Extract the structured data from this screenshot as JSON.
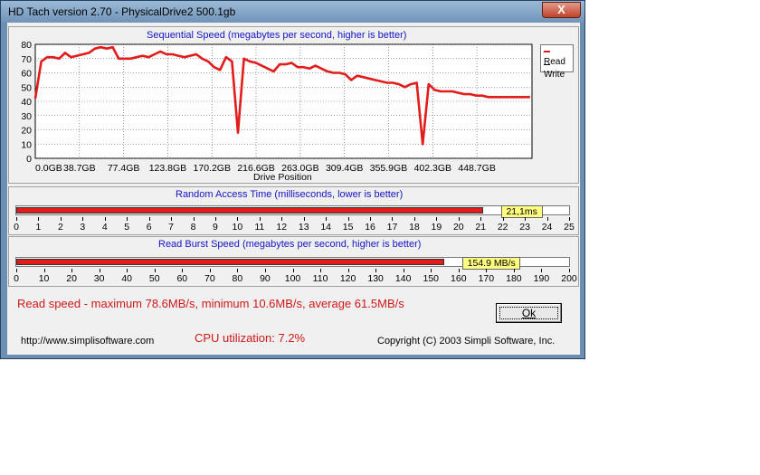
{
  "window": {
    "title": "HD Tach version 2.70 - PhysicalDrive2 500.1gb",
    "close_label": "X"
  },
  "sequential": {
    "title": "Sequential Speed (megabytes per second, higher is better)",
    "x_label": "Drive Position",
    "legend": {
      "read": "Read",
      "write": "Write"
    },
    "y_ticks": [
      "80",
      "70",
      "60",
      "50",
      "40",
      "30",
      "20",
      "10",
      "0"
    ],
    "x_ticks": [
      "0.0GB",
      "38.7GB",
      "77.4GB",
      "123.8GB",
      "170.2GB",
      "216.6GB",
      "263.0GB",
      "309.4GB",
      "355.9GB",
      "402.3GB",
      "448.7GB"
    ]
  },
  "chart_data": {
    "type": "line",
    "title": "Sequential Speed (megabytes per second, higher is better)",
    "xlabel": "Drive Position",
    "ylabel": "",
    "ylim": [
      0,
      80
    ],
    "xlim": [
      0,
      500
    ],
    "x_tick_labels": [
      "0.0GB",
      "38.7GB",
      "77.4GB",
      "123.8GB",
      "170.2GB",
      "216.6GB",
      "263.0GB",
      "309.4GB",
      "355.9GB",
      "402.3GB",
      "448.7GB"
    ],
    "grid": true,
    "legend_position": "top-right",
    "series": [
      {
        "name": "Read",
        "color": "#e21b1b",
        "x": [
          0,
          6,
          12,
          18,
          24,
          30,
          36,
          42,
          48,
          54,
          60,
          66,
          72,
          78,
          84,
          90,
          96,
          102,
          108,
          114,
          120,
          126,
          132,
          138,
          144,
          150,
          156,
          162,
          168,
          174,
          180,
          186,
          192,
          198,
          204,
          210,
          216,
          222,
          228,
          234,
          240,
          246,
          252,
          258,
          264,
          270,
          276,
          282,
          288,
          294,
          300,
          306,
          312,
          318,
          324,
          330,
          336,
          342,
          348,
          354,
          360,
          366,
          372,
          378,
          384,
          390,
          396,
          402,
          408,
          414,
          420,
          426,
          432,
          438,
          444,
          450,
          456,
          462,
          468,
          474,
          480,
          486,
          492,
          498
        ],
        "y": [
          42,
          68,
          71,
          71,
          70,
          74,
          71,
          72,
          73,
          74,
          77,
          78,
          77,
          78,
          70,
          70,
          70,
          71,
          72,
          71,
          73,
          75,
          73,
          73,
          72,
          71,
          72,
          73,
          70,
          68,
          64,
          62,
          71,
          68,
          18,
          70,
          68,
          67,
          65,
          63,
          61,
          66,
          66,
          67,
          64,
          64,
          63,
          65,
          63,
          61,
          60,
          60,
          59,
          55,
          58,
          57,
          56,
          55,
          54,
          53,
          53,
          52,
          50,
          52,
          53,
          10,
          52,
          48,
          47,
          47,
          47,
          46,
          45,
          45,
          44,
          44,
          43,
          43,
          43,
          43,
          43,
          43,
          43,
          43
        ]
      },
      {
        "name": "Write",
        "color": "#000000",
        "x": [],
        "y": []
      }
    ]
  },
  "random_access": {
    "title": "Random Access Time (milliseconds, lower is better)",
    "value": 21.1,
    "max": 25,
    "value_label": "21,1ms",
    "ticks": [
      "0",
      "1",
      "2",
      "3",
      "4",
      "5",
      "6",
      "7",
      "8",
      "9",
      "10",
      "11",
      "12",
      "13",
      "14",
      "15",
      "16",
      "17",
      "18",
      "19",
      "20",
      "21",
      "22",
      "23",
      "24",
      "25"
    ]
  },
  "burst": {
    "title": "Read Burst Speed (megabytes per second, higher is better)",
    "value": 154.9,
    "max": 200,
    "value_label": "154.9 MB/s",
    "ticks": [
      "0",
      "10",
      "20",
      "30",
      "40",
      "50",
      "60",
      "70",
      "80",
      "90",
      "100",
      "110",
      "120",
      "130",
      "140",
      "150",
      "160",
      "170",
      "180",
      "190",
      "200"
    ]
  },
  "summary": {
    "read_speed": "Read speed - maximum 78.6MB/s, minimum 10.6MB/s, average 61.5MB/s",
    "cpu": "CPU utilization: 7.2%"
  },
  "buttons": {
    "ok_label": "Ok"
  },
  "footer": {
    "url": "http://www.simplisoftware.com",
    "copyright": "Copyright (C) 2003 Simpli Software, Inc."
  }
}
